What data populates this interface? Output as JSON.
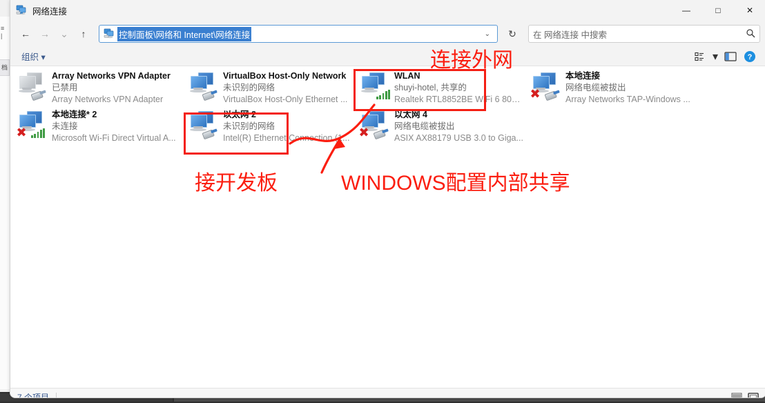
{
  "window": {
    "title": "网络连接",
    "icon": "network-connections-icon",
    "minimize_label": "—",
    "maximize_label": "□",
    "close_label": "✕"
  },
  "address_bar": {
    "back_label": "←",
    "forward_label": "→",
    "recent_label": "⌄",
    "up_label": "↑",
    "path": "控制面板\\网络和 Internet\\网络连接",
    "dropdown_label": "⌄",
    "refresh_label": "↻"
  },
  "search": {
    "placeholder": "在 网络连接 中搜索",
    "icon": "search-icon"
  },
  "command_bar": {
    "organize_label": "组织 ▾",
    "view_options_label": "",
    "view_caret_label": "▾",
    "preview_pane_label": "",
    "help_label": "?"
  },
  "status_bar": {
    "count_text": "7 个项目",
    "details_view_label": "",
    "large_icons_view_label": ""
  },
  "connections": [
    {
      "name": "Array Networks VPN Adapter",
      "status": "已禁用",
      "device": "Array Networks VPN Adapter",
      "icon_state": "gray",
      "has_plug": true,
      "has_bars": false,
      "has_x": false
    },
    {
      "name": "VirtualBox Host-Only Network",
      "status": "未识别的网络",
      "device": "VirtualBox Host-Only Ethernet ...",
      "icon_state": "blue",
      "has_plug": true,
      "has_bars": false,
      "has_x": false
    },
    {
      "name": "WLAN",
      "status": "shuyi-hotel, 共享的",
      "device": "Realtek RTL8852BE WiFi 6 802....",
      "icon_state": "blue",
      "has_plug": false,
      "has_bars": true,
      "has_x": false
    },
    {
      "name": "本地连接",
      "status": "网络电缆被拔出",
      "device": "Array Networks TAP-Windows ...",
      "icon_state": "blue",
      "has_plug": true,
      "has_bars": false,
      "has_x": true
    },
    {
      "name": "本地连接* 2",
      "status": "未连接",
      "device": "Microsoft Wi-Fi Direct Virtual A...",
      "icon_state": "blue",
      "has_plug": false,
      "has_bars": true,
      "has_x": true
    },
    {
      "name": "以太网 2",
      "status": "未识别的网络",
      "device": "Intel(R) Ethernet Connection (1...",
      "icon_state": "blue",
      "has_plug": true,
      "has_bars": false,
      "has_x": false
    },
    {
      "name": "以太网 4",
      "status": "网络电缆被拔出",
      "device": "ASIX AX88179 USB 3.0 to Giga...",
      "icon_state": "blue",
      "has_plug": true,
      "has_bars": false,
      "has_x": true
    }
  ],
  "annotations": {
    "accent_color": "#fb1e10",
    "labels": [
      {
        "text": "连接外网",
        "id": "annotation-wlan-label"
      },
      {
        "text": "接开发板",
        "id": "annotation-ethernet2-label"
      },
      {
        "text": "WINDOWS配置内部共享",
        "id": "annotation-sharing-label"
      }
    ],
    "boxes": [
      {
        "id": "annotation-box-wlan",
        "target": "WLAN"
      },
      {
        "id": "annotation-box-ethernet2",
        "target": "以太网 2"
      }
    ],
    "arrow": {
      "id": "annotation-arrow",
      "from": "以太网 2",
      "to": "WLAN"
    }
  }
}
